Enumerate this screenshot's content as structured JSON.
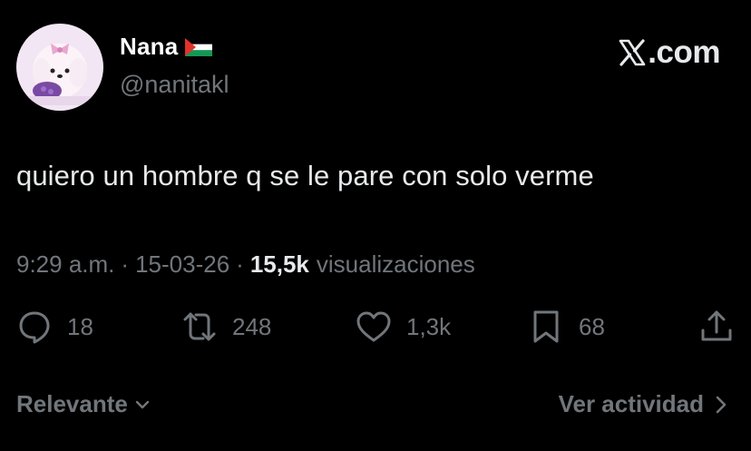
{
  "author": {
    "display_name": "Nana",
    "flag_icon": "palestine-flag-icon",
    "handle": "@nanitakl",
    "avatar_icon": "cartoon-dog-with-bow-avatar"
  },
  "brand": {
    "text": ".com",
    "icon": "x-logo-icon"
  },
  "tweet": {
    "text": "quiero un hombre q se le pare con solo verme",
    "time": "9:29 a.m.",
    "date": "15-03-26",
    "separator": "·",
    "views_count": "15,5k",
    "views_label": "visualizaciones"
  },
  "actions": {
    "replies": "18",
    "reposts": "248",
    "likes": "1,3k",
    "bookmarks": "68"
  },
  "footer": {
    "sort_label": "Relevante",
    "activity_label": "Ver actividad"
  },
  "colors": {
    "background": "#000000",
    "text": "#e7e9ea",
    "muted": "#71767b"
  }
}
